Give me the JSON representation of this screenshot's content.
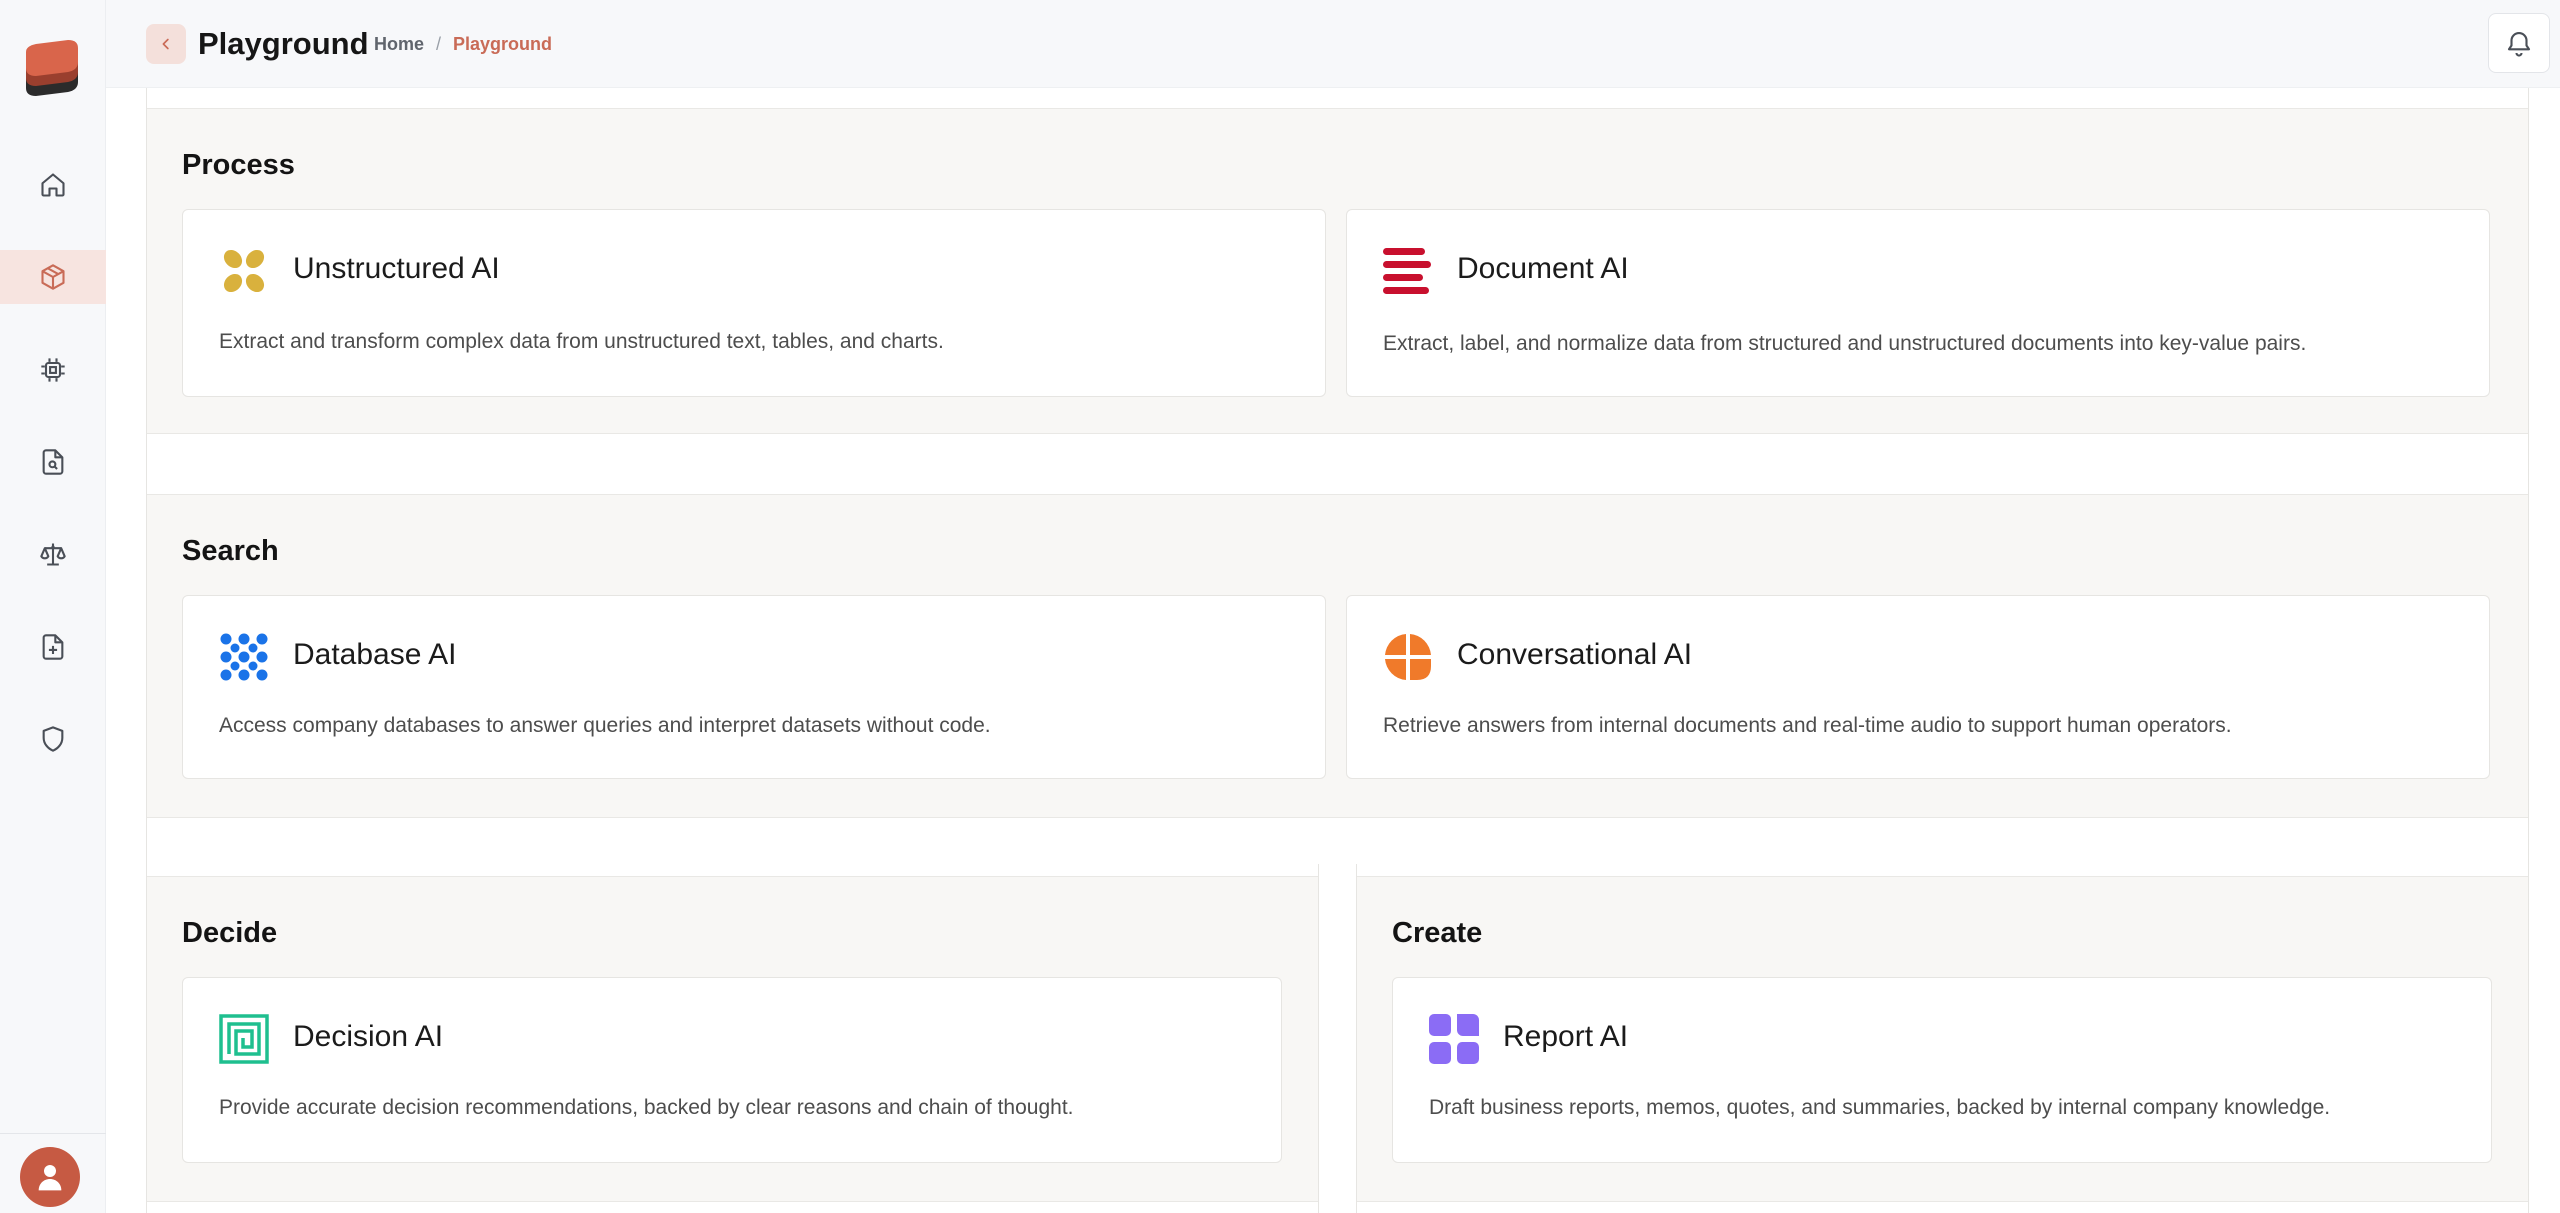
{
  "header": {
    "title": "Playground",
    "breadcrumb": {
      "home": "Home",
      "separator": "/",
      "current": "Playground"
    }
  },
  "sidebar": {
    "items": [
      {
        "icon": "home-icon",
        "active": false
      },
      {
        "icon": "cube-icon",
        "active": true
      },
      {
        "icon": "chip-icon",
        "active": false
      },
      {
        "icon": "file-search-icon",
        "active": false
      },
      {
        "icon": "scale-icon",
        "active": false
      },
      {
        "icon": "file-plus-icon",
        "active": false
      },
      {
        "icon": "shield-icon",
        "active": false
      }
    ]
  },
  "sections": {
    "process": {
      "title": "Process",
      "cards": [
        {
          "title": "Unstructured AI",
          "description": "Extract and transform complex data from unstructured text, tables, and charts.",
          "icon": "unstructured-ai-icon",
          "color": "#d9b13d"
        },
        {
          "title": "Document AI",
          "description": "Extract, label, and normalize data from structured and unstructured documents into key-value pairs.",
          "icon": "document-ai-icon",
          "color": "#c8102e"
        }
      ]
    },
    "search": {
      "title": "Search",
      "cards": [
        {
          "title": "Database AI",
          "description": "Access company databases to answer queries and interpret datasets without code.",
          "icon": "database-ai-icon",
          "color": "#1a73e8"
        },
        {
          "title": "Conversational AI",
          "description": "Retrieve answers from internal documents and real-time audio to support human operators.",
          "icon": "conversational-ai-icon",
          "color": "#f07a2a"
        }
      ]
    },
    "decide": {
      "title": "Decide",
      "cards": [
        {
          "title": "Decision AI",
          "description": "Provide accurate decision recommendations, backed by clear reasons and chain of thought.",
          "icon": "decision-ai-icon",
          "color": "#1fbf8f"
        }
      ]
    },
    "create": {
      "title": "Create",
      "cards": [
        {
          "title": "Report AI",
          "description": "Draft business reports, memos, quotes, and summaries, backed by internal company knowledge.",
          "icon": "report-ai-icon",
          "color": "#8b6cf5"
        }
      ]
    }
  },
  "colors": {
    "accent": "#c96b57",
    "active_bg": "#f7e4e0",
    "section_bg": "#f8f7f5"
  }
}
